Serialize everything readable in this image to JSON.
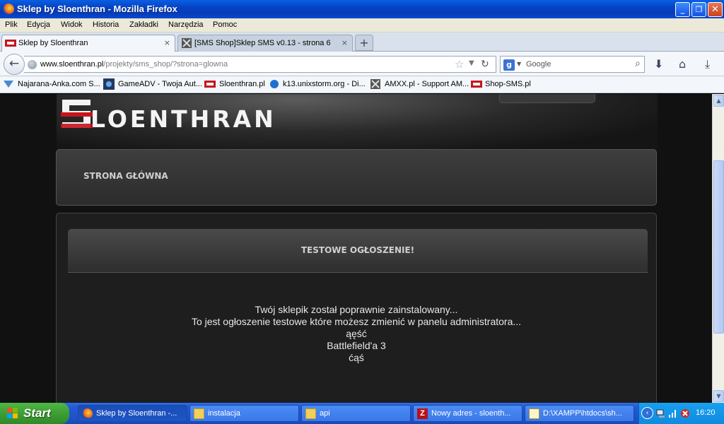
{
  "window": {
    "title": "Sklep by Sloenthran - Mozilla Firefox",
    "minimize_icon": "minimize-icon",
    "maximize_icon": "maximize-icon",
    "close_icon": "close-icon"
  },
  "menu": {
    "items": [
      "Plik",
      "Edycja",
      "Widok",
      "Historia",
      "Zakładki",
      "Narzędzia",
      "Pomoc"
    ]
  },
  "tabs": [
    {
      "label": "Sklep by Sloenthran",
      "close": "×",
      "active": true
    },
    {
      "label": "[SMS Shop]Sklep SMS v0.13 - strona 6 - ...",
      "close": "×",
      "active": false
    }
  ],
  "newtab": "+",
  "navbar": {
    "url_host": "www.sloenthran.pl",
    "url_path": "/projekty/sms_shop/?strona=glowna",
    "search_placeholder": "Google",
    "search_engine_letter": "g"
  },
  "bookmarks": [
    "Najarana-Anka.com S...",
    "GameADV - Twoja Aut...",
    "Sloenthran.pl",
    "k13.unixstorm.org - Di...",
    "AMXX.pl - Support AM...",
    "Shop-SMS.pl"
  ],
  "page": {
    "logo_text": "LOENTHRAN",
    "nav_link": "STRONA GŁÓWNA",
    "announcement_title": "TESTOWE OGŁOSZENIE!",
    "announcement_lines": [
      "Twój sklepik został poprawnie zainstalowany...",
      "To jest ogłoszenie testowe które możesz zmienić w panelu administratora...",
      "ąęść",
      "Battlefield'a 3",
      "ćąś"
    ]
  },
  "taskbar": {
    "start": "Start",
    "tasks": [
      "Sklep by Sloenthran -...",
      "instalacja",
      "api",
      "Nowy adres - sloenth...",
      "D:\\XAMPP\\htdocs\\sh..."
    ],
    "clock": "16:20"
  },
  "colors": {
    "accent_red": "#c8141e",
    "xp_blue": "#245ad6",
    "page_bg": "#111111"
  }
}
